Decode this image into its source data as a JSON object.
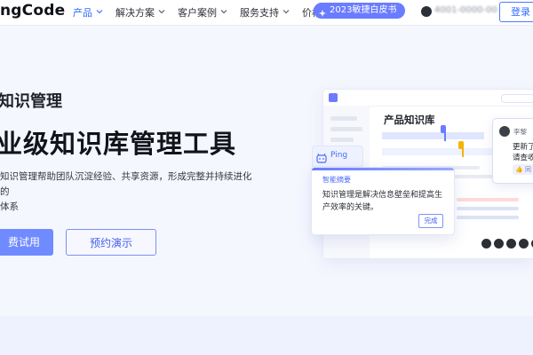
{
  "header": {
    "logo_text": "ngCode",
    "nav": [
      {
        "label": "产品",
        "has_chevron": true,
        "active": true
      },
      {
        "label": "解决方案",
        "has_chevron": true,
        "active": false
      },
      {
        "label": "客户案例",
        "has_chevron": true,
        "active": false
      },
      {
        "label": "服务支持",
        "has_chevron": true,
        "active": false
      },
      {
        "label": "价格",
        "has_chevron": false,
        "active": false
      }
    ],
    "badge_label": "2023敏捷白皮书",
    "phone_blurred": "4001-0000-00",
    "login_label": "登录"
  },
  "hero": {
    "eyebrow": "知识管理",
    "title": "业级知识库管理工具",
    "description_line1": "知识管理帮助团队沉淀经验、共享资源，形成完整并持续进化的",
    "description_line2": "体系",
    "primary_button": "费试用",
    "secondary_button": "预约演示"
  },
  "mockup": {
    "window_title": "产品知识库",
    "chat": {
      "name": "李黎",
      "line1": "更新了",
      "line2": "请查收",
      "like_label": "同"
    },
    "ping_label": "Ping",
    "summary_title": "智能摘要",
    "summary_body": "知识管理是解决信息壁垒和提高生产效率的关键。",
    "summary_done": "完成"
  },
  "colors": {
    "accent": "#2f6bff",
    "badge_bg": "#6a7cff",
    "primary_btn": "#6f8bff",
    "page_bg": "#f5f7ff"
  }
}
